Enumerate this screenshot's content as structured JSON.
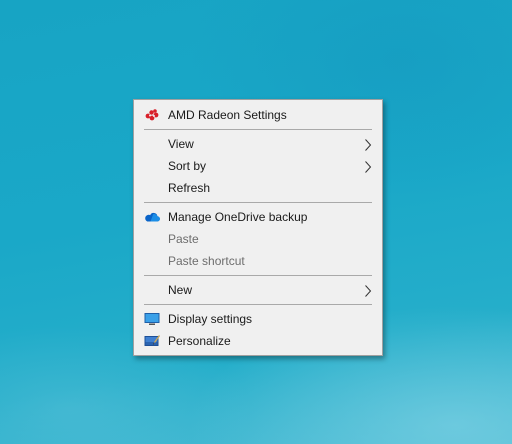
{
  "context_menu": {
    "items": [
      {
        "label": "AMD Radeon Settings",
        "icon": "amd-radeon-icon"
      },
      {
        "label": "View",
        "submenu": true
      },
      {
        "label": "Sort by",
        "submenu": true
      },
      {
        "label": "Refresh"
      },
      {
        "label": "Manage OneDrive backup",
        "icon": "onedrive-cloud-icon"
      },
      {
        "label": "Paste",
        "disabled": true
      },
      {
        "label": "Paste shortcut",
        "disabled": true
      },
      {
        "label": "New",
        "submenu": true
      },
      {
        "label": "Display settings",
        "icon": "display-monitor-icon"
      },
      {
        "label": "Personalize",
        "icon": "personalize-icon"
      }
    ]
  },
  "colors": {
    "desktop_background": "#1aa8c8",
    "menu_background": "#f0f0f0",
    "separator": "#a9a9a9",
    "disabled_text": "#6d6d6d",
    "amd_red": "#d8202a",
    "onedrive_blue": "#0a64c8"
  }
}
